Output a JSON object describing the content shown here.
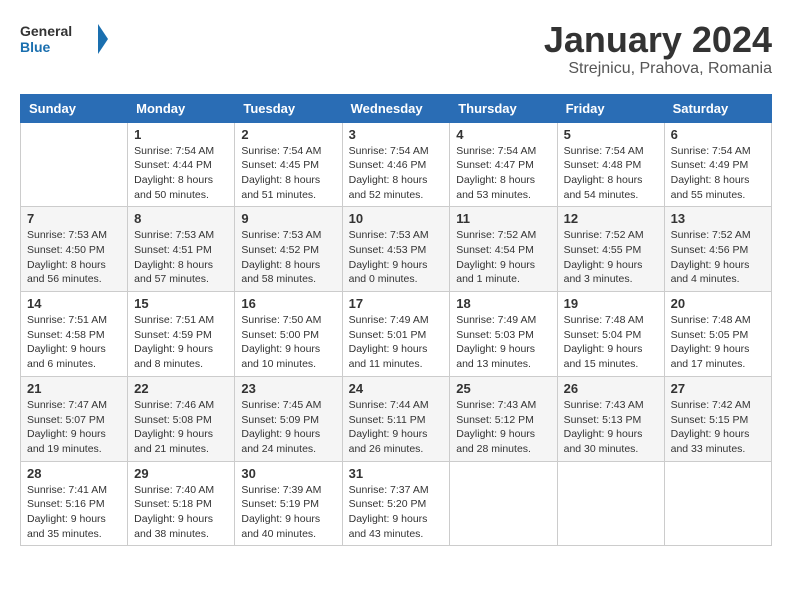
{
  "header": {
    "logo_general": "General",
    "logo_blue": "Blue",
    "month_title": "January 2024",
    "location": "Strejnicu, Prahova, Romania"
  },
  "days_of_week": [
    "Sunday",
    "Monday",
    "Tuesday",
    "Wednesday",
    "Thursday",
    "Friday",
    "Saturday"
  ],
  "weeks": [
    [
      {
        "day": "",
        "info": ""
      },
      {
        "day": "1",
        "info": "Sunrise: 7:54 AM\nSunset: 4:44 PM\nDaylight: 8 hours\nand 50 minutes."
      },
      {
        "day": "2",
        "info": "Sunrise: 7:54 AM\nSunset: 4:45 PM\nDaylight: 8 hours\nand 51 minutes."
      },
      {
        "day": "3",
        "info": "Sunrise: 7:54 AM\nSunset: 4:46 PM\nDaylight: 8 hours\nand 52 minutes."
      },
      {
        "day": "4",
        "info": "Sunrise: 7:54 AM\nSunset: 4:47 PM\nDaylight: 8 hours\nand 53 minutes."
      },
      {
        "day": "5",
        "info": "Sunrise: 7:54 AM\nSunset: 4:48 PM\nDaylight: 8 hours\nand 54 minutes."
      },
      {
        "day": "6",
        "info": "Sunrise: 7:54 AM\nSunset: 4:49 PM\nDaylight: 8 hours\nand 55 minutes."
      }
    ],
    [
      {
        "day": "7",
        "info": "Sunrise: 7:53 AM\nSunset: 4:50 PM\nDaylight: 8 hours\nand 56 minutes."
      },
      {
        "day": "8",
        "info": "Sunrise: 7:53 AM\nSunset: 4:51 PM\nDaylight: 8 hours\nand 57 minutes."
      },
      {
        "day": "9",
        "info": "Sunrise: 7:53 AM\nSunset: 4:52 PM\nDaylight: 8 hours\nand 58 minutes."
      },
      {
        "day": "10",
        "info": "Sunrise: 7:53 AM\nSunset: 4:53 PM\nDaylight: 9 hours\nand 0 minutes."
      },
      {
        "day": "11",
        "info": "Sunrise: 7:52 AM\nSunset: 4:54 PM\nDaylight: 9 hours\nand 1 minute."
      },
      {
        "day": "12",
        "info": "Sunrise: 7:52 AM\nSunset: 4:55 PM\nDaylight: 9 hours\nand 3 minutes."
      },
      {
        "day": "13",
        "info": "Sunrise: 7:52 AM\nSunset: 4:56 PM\nDaylight: 9 hours\nand 4 minutes."
      }
    ],
    [
      {
        "day": "14",
        "info": "Sunrise: 7:51 AM\nSunset: 4:58 PM\nDaylight: 9 hours\nand 6 minutes."
      },
      {
        "day": "15",
        "info": "Sunrise: 7:51 AM\nSunset: 4:59 PM\nDaylight: 9 hours\nand 8 minutes."
      },
      {
        "day": "16",
        "info": "Sunrise: 7:50 AM\nSunset: 5:00 PM\nDaylight: 9 hours\nand 10 minutes."
      },
      {
        "day": "17",
        "info": "Sunrise: 7:49 AM\nSunset: 5:01 PM\nDaylight: 9 hours\nand 11 minutes."
      },
      {
        "day": "18",
        "info": "Sunrise: 7:49 AM\nSunset: 5:03 PM\nDaylight: 9 hours\nand 13 minutes."
      },
      {
        "day": "19",
        "info": "Sunrise: 7:48 AM\nSunset: 5:04 PM\nDaylight: 9 hours\nand 15 minutes."
      },
      {
        "day": "20",
        "info": "Sunrise: 7:48 AM\nSunset: 5:05 PM\nDaylight: 9 hours\nand 17 minutes."
      }
    ],
    [
      {
        "day": "21",
        "info": "Sunrise: 7:47 AM\nSunset: 5:07 PM\nDaylight: 9 hours\nand 19 minutes."
      },
      {
        "day": "22",
        "info": "Sunrise: 7:46 AM\nSunset: 5:08 PM\nDaylight: 9 hours\nand 21 minutes."
      },
      {
        "day": "23",
        "info": "Sunrise: 7:45 AM\nSunset: 5:09 PM\nDaylight: 9 hours\nand 24 minutes."
      },
      {
        "day": "24",
        "info": "Sunrise: 7:44 AM\nSunset: 5:11 PM\nDaylight: 9 hours\nand 26 minutes."
      },
      {
        "day": "25",
        "info": "Sunrise: 7:43 AM\nSunset: 5:12 PM\nDaylight: 9 hours\nand 28 minutes."
      },
      {
        "day": "26",
        "info": "Sunrise: 7:43 AM\nSunset: 5:13 PM\nDaylight: 9 hours\nand 30 minutes."
      },
      {
        "day": "27",
        "info": "Sunrise: 7:42 AM\nSunset: 5:15 PM\nDaylight: 9 hours\nand 33 minutes."
      }
    ],
    [
      {
        "day": "28",
        "info": "Sunrise: 7:41 AM\nSunset: 5:16 PM\nDaylight: 9 hours\nand 35 minutes."
      },
      {
        "day": "29",
        "info": "Sunrise: 7:40 AM\nSunset: 5:18 PM\nDaylight: 9 hours\nand 38 minutes."
      },
      {
        "day": "30",
        "info": "Sunrise: 7:39 AM\nSunset: 5:19 PM\nDaylight: 9 hours\nand 40 minutes."
      },
      {
        "day": "31",
        "info": "Sunrise: 7:37 AM\nSunset: 5:20 PM\nDaylight: 9 hours\nand 43 minutes."
      },
      {
        "day": "",
        "info": ""
      },
      {
        "day": "",
        "info": ""
      },
      {
        "day": "",
        "info": ""
      }
    ]
  ]
}
